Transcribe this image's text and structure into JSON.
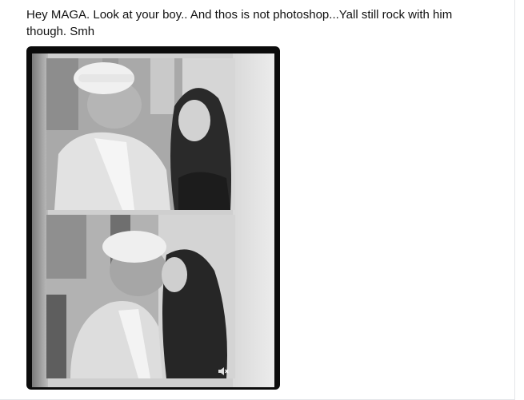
{
  "post": {
    "text": "Hey MAGA. Look at your boy.. And thos is not photoshop...Yall still rock with him though. Smh"
  },
  "media": {
    "kind": "video",
    "muted_icon": "speaker-muted-icon"
  }
}
